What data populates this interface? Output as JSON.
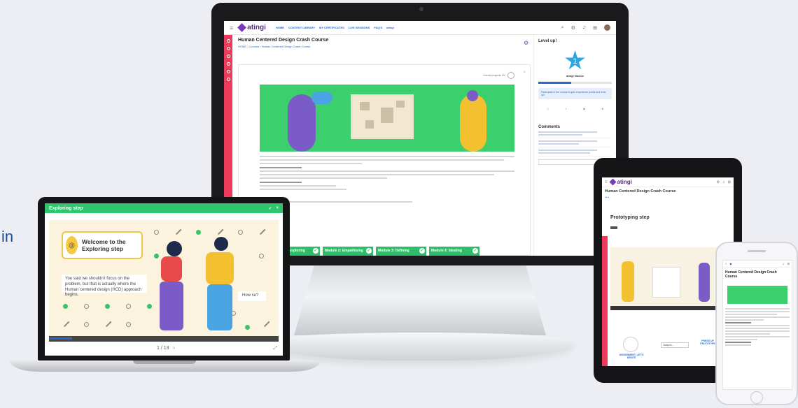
{
  "edge_text": "in",
  "desktop": {
    "logo": "atingi",
    "nav": [
      "HOME",
      "CONTENT LIBRARY",
      "MY CERTIFICATES",
      "LIVE SESSIONS",
      "FAQ'S",
      "atingi"
    ],
    "page_title": "Human Centered Design Crash Course",
    "breadcrumb": "HOME / Courses / Human Centered Design Crash Course",
    "progress_label": "Overall progress 0%",
    "progress_value": 0,
    "modules": [
      "Module 1: Exploring",
      "Module 2: Empathising",
      "Module 3: Defining",
      "Module 4: Ideating"
    ],
    "level_title": "Level up!",
    "level_number": "1",
    "level_name": "atingi Novice",
    "level_progress": 0.45,
    "level_tip": "Participate in the course to gain experience points and level up!",
    "comments_title": "Comments"
  },
  "laptop": {
    "header": "Exploring step",
    "welcome_text": "Welcome to the Exploring step",
    "speech_text": "You said we shouldn't focus on the problem, but that is actually where the Human centered design (HCD) approach begins.",
    "reply_text": "How so?",
    "pager": "1 / 13",
    "progress": 0.1
  },
  "tablet": {
    "logo": "atingi",
    "title": "Human Centered Design Crash Course",
    "step_title": "Prototyping step",
    "select_value": "Jump to...",
    "prev_label": "ASSIGNMENT: LET'S IDEATE",
    "next_label": "PRESS UP PROTOTYPE"
  },
  "phone": {
    "title": "Human Centered Design Crash Course"
  }
}
